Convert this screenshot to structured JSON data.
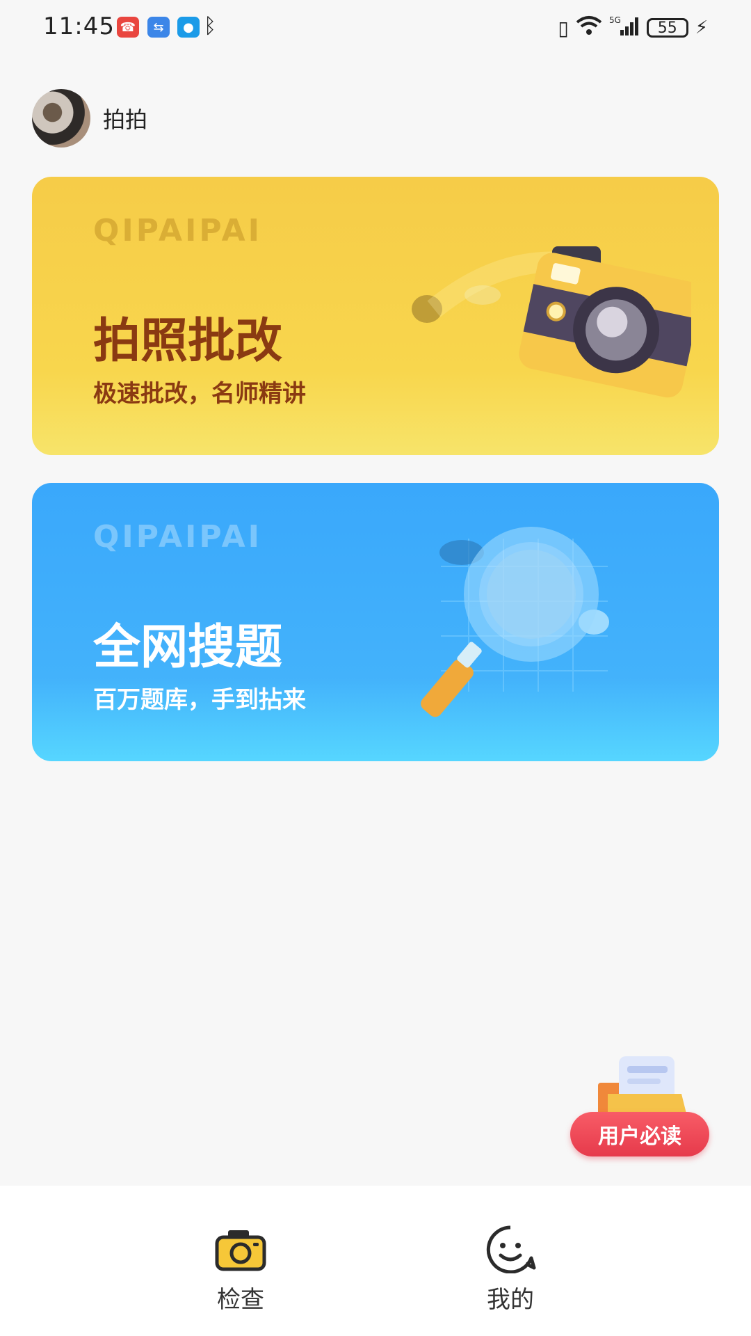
{
  "status_bar": {
    "time": "11:45",
    "battery": "55",
    "icons": [
      "missed-call-icon",
      "usb-icon",
      "message-icon",
      "bluetooth-icon",
      "vibrate-icon",
      "wifi-icon",
      "5g-signal-icon",
      "battery-icon",
      "charging-icon"
    ],
    "signal_label": "5G"
  },
  "profile": {
    "name": "拍拍"
  },
  "cards": [
    {
      "watermark": "QIPAIPAI",
      "title": "拍照批改",
      "subtitle": "极速批改，名师精讲",
      "icon": "camera-icon",
      "color": "#f7cf49"
    },
    {
      "watermark": "QIPAIPAI",
      "title": "全网搜题",
      "subtitle": "百万题库，手到拈来",
      "icon": "magnifier-icon",
      "color": "#3aa8fb"
    }
  ],
  "floating": {
    "label": "用户必读",
    "color": "#e94150"
  },
  "bottom_nav": {
    "items": [
      {
        "label": "检查",
        "icon": "camera-icon",
        "active": true
      },
      {
        "label": "我的",
        "icon": "smiley-icon",
        "active": false
      }
    ]
  }
}
